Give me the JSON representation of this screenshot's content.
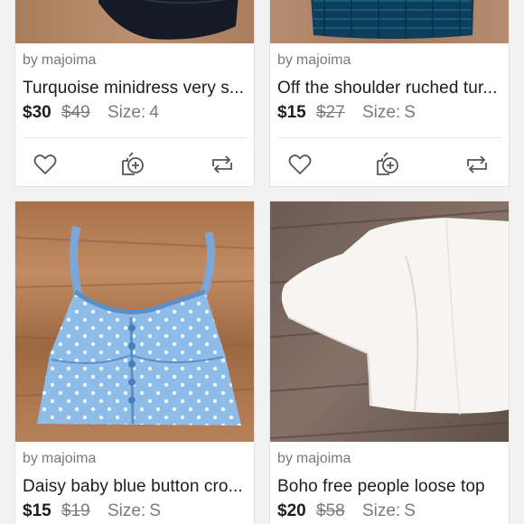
{
  "listings": [
    {
      "seller_prefix": "by",
      "seller": "majoima",
      "title": "Turquoise minidress very s...",
      "price": "$30",
      "original_price": "$49",
      "size_label": "Size:",
      "size_value": "4",
      "image": "navy-garment-photo"
    },
    {
      "seller_prefix": "by",
      "seller": "majoima",
      "title": "Off the shoulder ruched tur...",
      "price": "$15",
      "original_price": "$27",
      "size_label": "Size:",
      "size_value": "S",
      "image": "teal-ruched-top-photo"
    },
    {
      "seller_prefix": "by",
      "seller": "majoima",
      "title": "Daisy baby blue button cro...",
      "price": "$15",
      "original_price": "$19",
      "size_label": "Size:",
      "size_value": "S",
      "image": "blue-daisy-crop-top-photo"
    },
    {
      "seller_prefix": "by",
      "seller": "majoima",
      "title": "Boho free people loose top",
      "price": "$20",
      "original_price": "$58",
      "size_label": "Size:",
      "size_value": "S",
      "image": "white-loose-top-photo"
    }
  ],
  "actions": {
    "like_icon": "heart-outline-icon",
    "bundle_icon": "bundle-add-icon",
    "share_icon": "share-repost-icon"
  },
  "colors": {
    "background": "#f2f2f2",
    "card": "#ffffff",
    "text": "#1d1d1d",
    "muted": "#7a7a7a"
  }
}
